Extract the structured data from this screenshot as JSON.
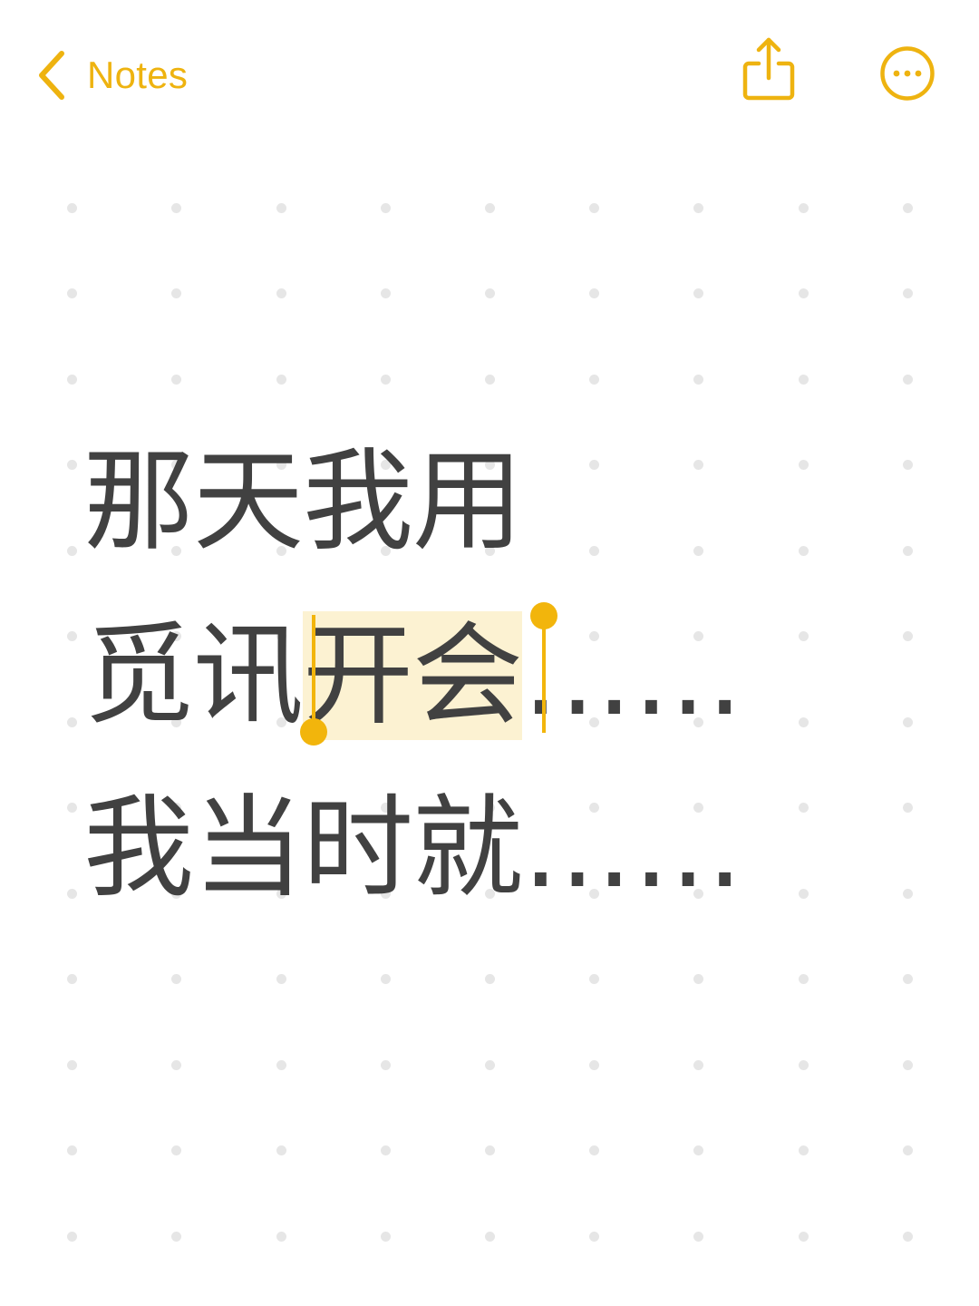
{
  "nav": {
    "back_label": "Notes"
  },
  "icons": {
    "back": "chevron-left-icon",
    "share": "share-icon",
    "more": "more-circle-icon"
  },
  "colors": {
    "accent": "#eeb310",
    "text": "#414141",
    "selection": "#fcf2d2",
    "grid_dot": "#e6e6e6",
    "background": "#ffffff"
  },
  "note": {
    "line1": "那天我用",
    "line2_before": "觅讯",
    "line2_selected": "开会",
    "line2_after": "……",
    "line3_text": "我当时就",
    "line3_after": "……"
  }
}
